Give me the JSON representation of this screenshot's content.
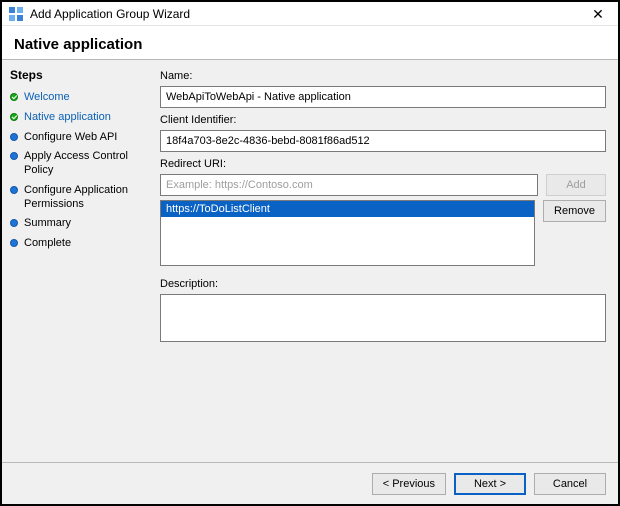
{
  "window": {
    "title": "Add Application Group Wizard",
    "close_glyph": "✕"
  },
  "page_title": "Native application",
  "steps_title": "Steps",
  "steps": [
    {
      "label": "Welcome",
      "state": "done",
      "link": true
    },
    {
      "label": "Native application",
      "state": "done",
      "active": true
    },
    {
      "label": "Configure Web API",
      "state": "pending"
    },
    {
      "label": "Apply Access Control Policy",
      "state": "pending"
    },
    {
      "label": "Configure Application Permissions",
      "state": "pending"
    },
    {
      "label": "Summary",
      "state": "pending"
    },
    {
      "label": "Complete",
      "state": "pending"
    }
  ],
  "form": {
    "name_label": "Name:",
    "name_value": "WebApiToWebApi - Native application",
    "client_id_label": "Client Identifier:",
    "client_id_value": "18f4a703-8e2c-4836-bebd-8081f86ad512",
    "redirect_label": "Redirect URI:",
    "redirect_placeholder": "Example: https://Contoso.com",
    "redirect_list": [
      "https://ToDoListClient"
    ],
    "add_label": "Add",
    "remove_label": "Remove",
    "description_label": "Description:",
    "description_value": ""
  },
  "buttons": {
    "previous": "< Previous",
    "next": "Next >",
    "cancel": "Cancel"
  },
  "icons": {
    "app": "app-group-icon",
    "close": "close-icon"
  }
}
